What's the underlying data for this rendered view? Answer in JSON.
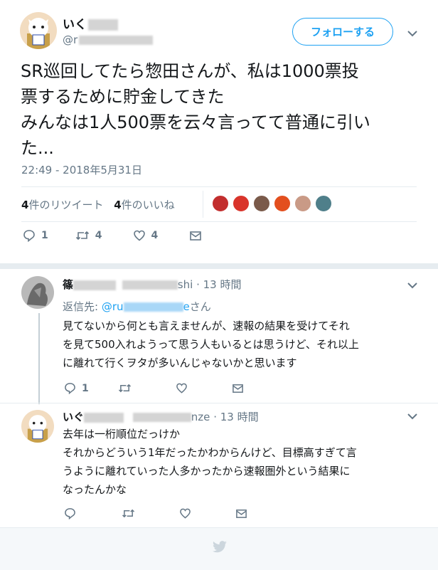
{
  "tweet": {
    "author_name": "いく",
    "author_handle": "@r",
    "follow_label": "フォローする",
    "text_lines": [
      "SR巡回してたら惣田さんが、私は1000票投",
      "票するために貯金してきた",
      "みんなは1人500票を云々言ってて普通に引い",
      "た..."
    ],
    "timestamp": "22:49 - 2018年5月31日",
    "retweets_count": "4",
    "retweets_label": "件のリツイート",
    "likes_count": "4",
    "likes_label": "件のいいね",
    "actions": {
      "reply_count": "1",
      "retweet_count": "4",
      "like_count": "4"
    }
  },
  "replies": [
    {
      "name": "篠",
      "handle_tail": "shi",
      "time": "· 13 時間",
      "reply_to_label": "返信先:",
      "reply_to_handle_head": "@ru",
      "reply_to_handle_tail": "e",
      "reply_to_suffix": "さん",
      "body_lines": [
        "見てないから何とも言えませんが、速報の結果を受けてそれ",
        "を見て500入れようって思う人もいるとは思うけど、それ以上",
        "に離れて行くヲタが多いんじゃないかと思います"
      ],
      "reply_count": "1"
    },
    {
      "name": "いぐ",
      "handle_tail": "nze",
      "time": "· 13 時間",
      "body_lines": [
        "去年は一桁順位だっけか",
        "それからどういう1年だったかわからんけど、目標高すぎて言",
        "うように離れていった人多かったから速報圏外という結果に",
        "なったんかな"
      ]
    }
  ],
  "colors": {
    "accent": "#1da1f2",
    "muted": "#657786",
    "text": "#14171a",
    "divider": "#e6ecf0"
  },
  "icons": [
    "reply-icon",
    "retweet-icon",
    "like-icon",
    "dm-icon",
    "chevron-down-icon",
    "twitter-bird-icon"
  ]
}
